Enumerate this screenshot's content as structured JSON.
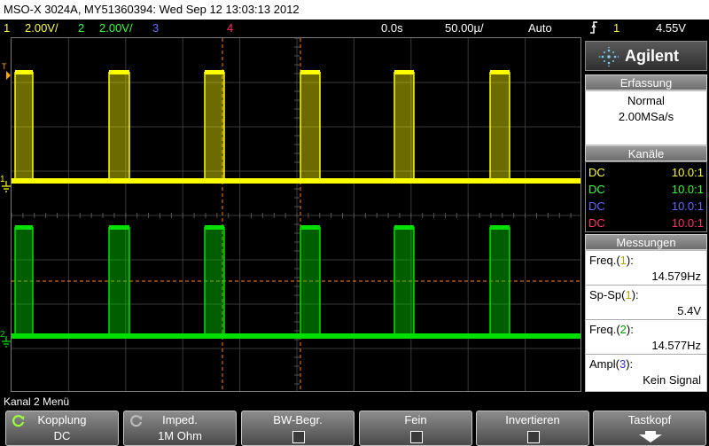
{
  "title": "MSO-X 3024A, MY51360394: Wed Sep 12 13:03:13 2012",
  "status": {
    "ch1_num": "1",
    "ch1_scale": "2.00V/",
    "ch2_num": "2",
    "ch2_scale": "2.00V/",
    "ch3_num": "3",
    "ch4_num": "4",
    "time_delay": "0.0s",
    "time_scale": "50.00µ/",
    "trigger_mode": "Auto",
    "trigger_source": "1",
    "trigger_level": "4.55V",
    "trigger_icon": "trigger-edge-icon"
  },
  "brand": {
    "name": "Agilent",
    "logo_icon": "agilent-spark-icon"
  },
  "acquisition": {
    "header": "Erfassung",
    "mode": "Normal",
    "rate": "2.00MSa/s"
  },
  "channels": {
    "header": "Kanäle",
    "rows": [
      {
        "coupling": "DC",
        "probe": "10.0:1",
        "color": "#ffff33"
      },
      {
        "coupling": "DC",
        "probe": "10.0:1",
        "color": "#33ff33"
      },
      {
        "coupling": "DC",
        "probe": "10.0:1",
        "color": "#6666ff"
      },
      {
        "coupling": "DC",
        "probe": "10.0:1",
        "color": "#ff3366"
      }
    ]
  },
  "measurements": {
    "header": "Messungen",
    "items": [
      {
        "label": "Freq.(",
        "ch": "1",
        "close": "):",
        "value": "14.579Hz"
      },
      {
        "label": "Sp-Sp(",
        "ch": "1",
        "close": "):",
        "value": "5.4V"
      },
      {
        "label": "Freq.(",
        "ch": "2",
        "close": "):",
        "value": "14.577Hz"
      },
      {
        "label": "Ampl(",
        "ch": "3",
        "close": "):",
        "value": "Kein Signal"
      }
    ]
  },
  "waveform": {
    "ch1_marker": "1",
    "ch2_marker": "2",
    "trigger_marker": "T",
    "ch1_color": "#ffff00",
    "ch2_color": "#00e000",
    "cursor_color": "#ff7f1a"
  },
  "menu_title": "Kanal 2 Menü",
  "softkeys": [
    {
      "label": "Kopplung",
      "value": "DC",
      "icon": "rotate-knob-icon"
    },
    {
      "label": "Imped.",
      "value": "1M Ohm",
      "icon": "rotate-knob-icon"
    },
    {
      "label": "BW-Begr.",
      "value": "",
      "icon": "checkbox-icon"
    },
    {
      "label": "Fein",
      "value": "",
      "icon": "checkbox-icon"
    },
    {
      "label": "Invertieren",
      "value": "",
      "icon": "checkbox-icon"
    },
    {
      "label": "Tastkopf",
      "value": "",
      "icon": "arrow-down-icon"
    }
  ]
}
